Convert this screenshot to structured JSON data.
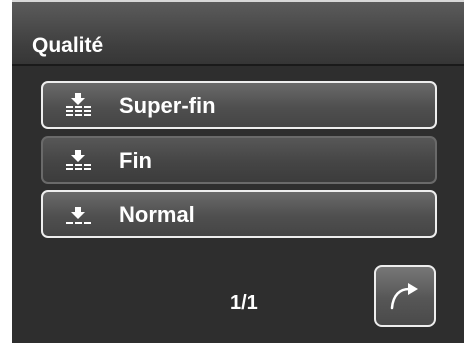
{
  "header": {
    "title": "Qualité"
  },
  "options": [
    {
      "label": "Super-fin",
      "icon": "quality-superfine-icon",
      "selected": false
    },
    {
      "label": "Fin",
      "icon": "quality-fine-icon",
      "selected": true
    },
    {
      "label": "Normal",
      "icon": "quality-normal-icon",
      "selected": false
    }
  ],
  "footer": {
    "page": "1/1",
    "next_icon": "return-arrow-icon"
  },
  "colors": {
    "background": "#2e2e2e",
    "header": "#474747",
    "button_border": "#eeeeee",
    "text": "#ffffff"
  }
}
